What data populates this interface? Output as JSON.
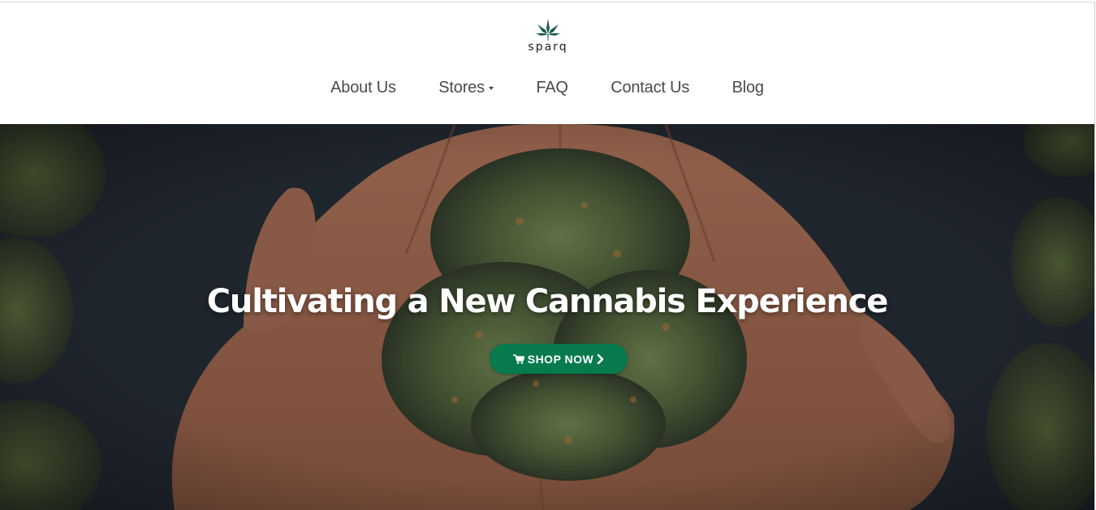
{
  "brand": {
    "name": "sparq",
    "logo_icon": "cannabis-leaf-icon",
    "accent": "#1a5c4a"
  },
  "nav": {
    "items": [
      {
        "label": "About Us",
        "has_dropdown": false
      },
      {
        "label": "Stores",
        "has_dropdown": true
      },
      {
        "label": "FAQ",
        "has_dropdown": false
      },
      {
        "label": "Contact Us",
        "has_dropdown": false
      },
      {
        "label": "Blog",
        "has_dropdown": false
      }
    ]
  },
  "hero": {
    "title": "Cultivating a New Cannabis Experience",
    "cta": {
      "label": "SHOP NOW",
      "icon_left": "shopping-cart-icon",
      "icon_right": "chevron-right-icon",
      "color": "#077a4e"
    }
  }
}
